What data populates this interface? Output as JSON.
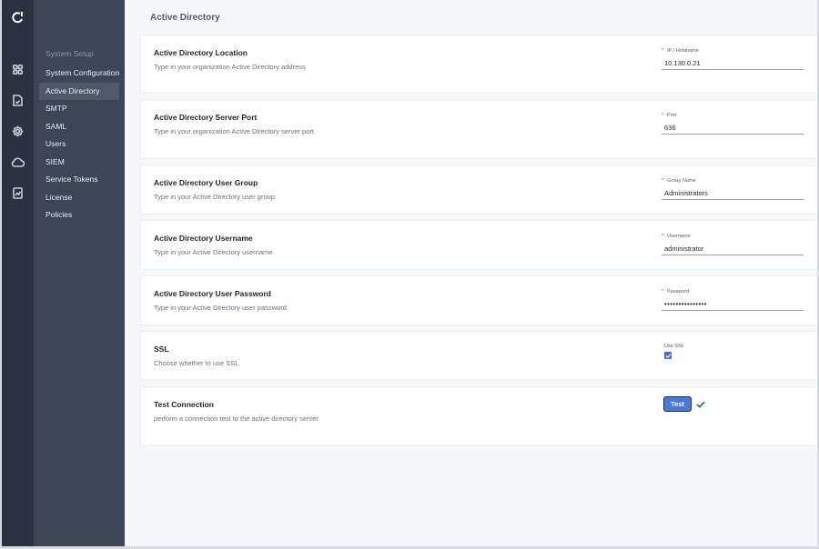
{
  "rail": {
    "icons": [
      "logo-icon",
      "dashboard-grid-icon",
      "document-icon",
      "settings-gear-icon",
      "cloud-icon",
      "report-icon"
    ]
  },
  "subnav": {
    "heading": "System Setup",
    "items": [
      {
        "label": "System Configuration",
        "active": false
      },
      {
        "label": "Active Directory",
        "active": true
      },
      {
        "label": "SMTP",
        "active": false
      },
      {
        "label": "SAML",
        "active": false
      },
      {
        "label": "Users",
        "active": false
      },
      {
        "label": "SIEM",
        "active": false
      },
      {
        "label": "Service Tokens",
        "active": false
      },
      {
        "label": "License",
        "active": false
      },
      {
        "label": "Policies",
        "active": false
      }
    ]
  },
  "page": {
    "title": "Active Directory"
  },
  "sections": {
    "location": {
      "title": "Active Directory Location",
      "desc": "Type in your organization Active Directory address",
      "required_mark": "*",
      "field_label": "IP / Hostname",
      "value": "10.130.0.21"
    },
    "port": {
      "title": "Active Directory Server Port",
      "desc": "Type in your organization Active Directory server port",
      "required_mark": "*",
      "field_label": "Port",
      "value": "636"
    },
    "group": {
      "title": "Active Directory User Group",
      "desc": "Type in your Active Directory user group",
      "required_mark": "*",
      "field_label": "Group Name",
      "value": "Administrators"
    },
    "username": {
      "title": "Active Directory Username",
      "desc": "Type in your Active Directory username",
      "required_mark": "*",
      "field_label": "Username",
      "value": "administrator"
    },
    "password": {
      "title": "Active Directory User Password",
      "desc": "Type in your Active Directory user password",
      "required_mark": "*",
      "field_label": "Password",
      "value": "•••••••••••••••"
    },
    "ssl": {
      "title": "SSL",
      "desc": "Choose whether to use SSL",
      "field_label": "Use SSL",
      "checked": true
    },
    "test": {
      "title": "Test Connection",
      "desc": "perform a connection test to the active directory server",
      "button_label": "Test",
      "status_icon": "check-success-icon"
    }
  },
  "colors": {
    "rail_bg": "#2b3140",
    "subnav_bg": "#3d4556",
    "subnav_active": "#4f5768",
    "accent": "#4c79d6",
    "success": "#1e8e3e",
    "required": "#d03030"
  }
}
